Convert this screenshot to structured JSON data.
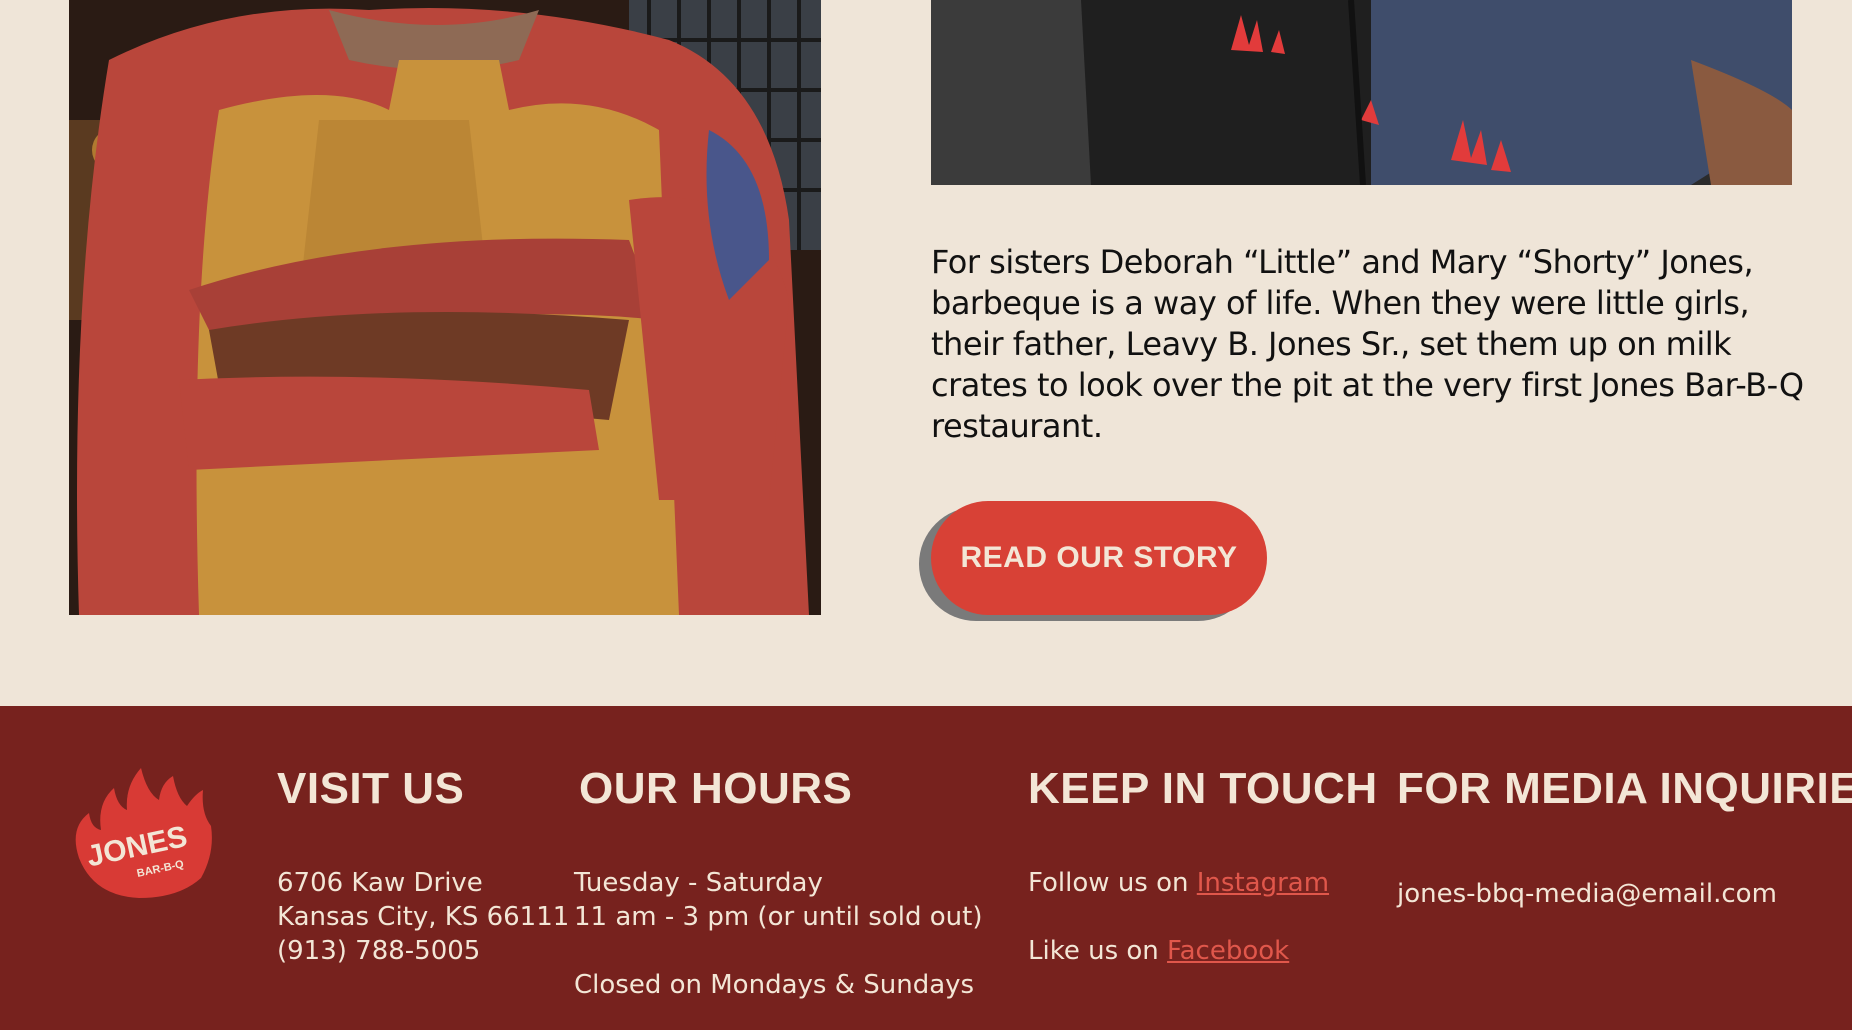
{
  "story": {
    "paragraph": "For sisters Deborah “Little” and Mary “Shorty” Jones, barbeque is a way of life. When they were little girls, their father, Leavy B. Jones Sr., set them up on milk crates to look over the pit at the very first Jones Bar-B-Q restaurant.",
    "button_label": "READ OUR STORY"
  },
  "footer": {
    "logo": {
      "name": "JONES",
      "sub": "BAR-B-Q"
    },
    "visit": {
      "title": "VISIT US",
      "lines": [
        "6706 Kaw Drive",
        "Kansas City, KS 66111",
        "(913) 788-5005"
      ]
    },
    "hours": {
      "title": "OUR HOURS",
      "days": "Tuesday - Saturday",
      "time": "11 am - 3 pm (or until sold out)",
      "closed": "Closed on Mondays & Sundays"
    },
    "touch": {
      "title": "KEEP IN TOUCH",
      "follow_prefix": "Follow us on",
      "follow_link": "Instagram",
      "like_prefix": "Like us on",
      "like_link": "Facebook"
    },
    "media": {
      "title": "FOR MEDIA INQUIRIES",
      "email": "jones-bbq-media@email.com"
    }
  },
  "colors": {
    "background": "#efe5d8",
    "footer": "#77221e",
    "accent": "#d84136",
    "link": "#e0574b",
    "cream": "#f3e6d6"
  }
}
